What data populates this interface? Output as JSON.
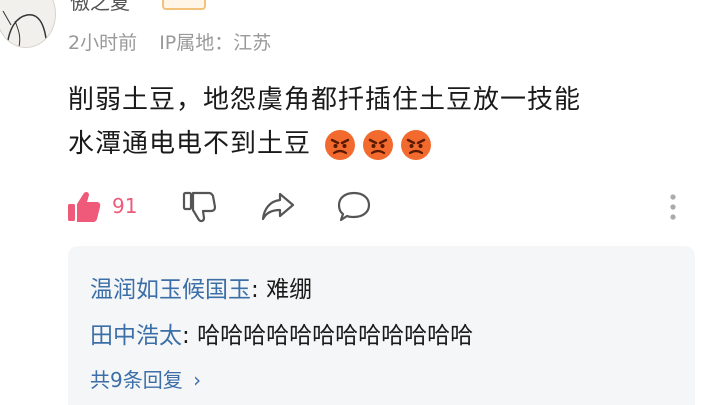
{
  "header": {
    "username": "傲之夏",
    "time_ago": "2小时前",
    "ip_location": "IP属地：江苏"
  },
  "comment": {
    "line1": "削弱土豆，地怨虞角都扦插住土豆放一技能",
    "line2": "水潭通电电不到土豆",
    "emojis": [
      "angry-face-emoji",
      "angry-face-emoji",
      "angry-face-emoji"
    ]
  },
  "actions": {
    "like_count": "91",
    "like_color": "#ef5a7a"
  },
  "replies": {
    "items": [
      {
        "name": "温润如玉候国玉",
        "separator": ": ",
        "text": "难绷"
      },
      {
        "name": "田中浩太",
        "separator": ": ",
        "text": "哈哈哈哈哈哈哈哈哈哈哈哈"
      }
    ],
    "more_label": "共9条回复",
    "more_chevron": "›",
    "name_color": "#3c6fa8"
  }
}
